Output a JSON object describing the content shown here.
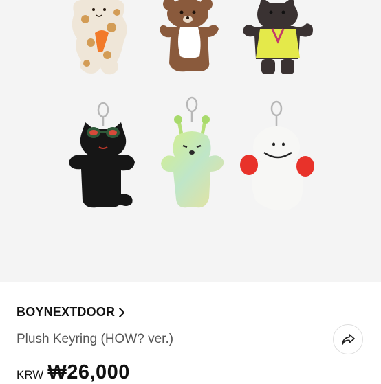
{
  "product": {
    "brand": "BOYNEXTDOOR",
    "name": "Plush Keyring (HOW? ver.)",
    "currency": "KRW",
    "price": "₩26,000"
  },
  "icons": {
    "brand_chevron": "chevron-right-icon",
    "share": "share-icon"
  },
  "colors": {
    "image_background": "#f4f4f4",
    "text_primary": "#111111",
    "text_secondary": "#555555"
  }
}
